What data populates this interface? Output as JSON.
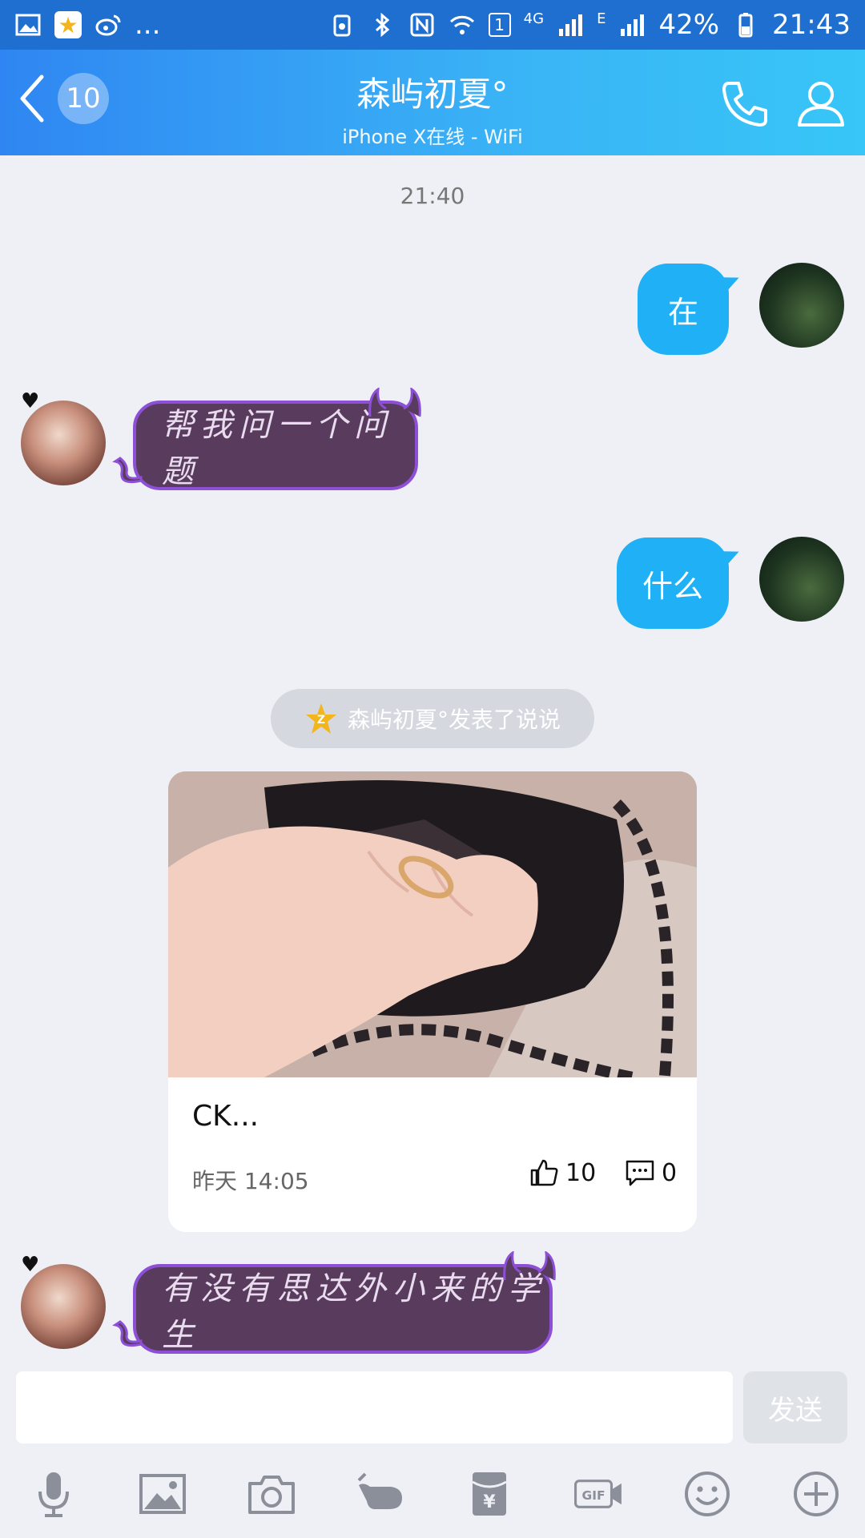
{
  "status_bar": {
    "left_overflow": "...",
    "network_4g": "4G",
    "network_e": "E",
    "sim_badge": "1",
    "battery": "42%",
    "time": "21:43"
  },
  "header": {
    "unread_count": "10",
    "title": "森屿初夏°",
    "subtitle": "iPhone X在线 - WiFi"
  },
  "chat": {
    "time_divider": "21:40",
    "messages": [
      {
        "side": "right",
        "text": "在"
      },
      {
        "side": "left",
        "text": "帮我问一个问题"
      },
      {
        "side": "right",
        "text": "什么"
      },
      {
        "side": "left",
        "text": "有没有思达外小来的学生"
      }
    ],
    "system_notice": "森屿初夏°发表了说说",
    "shared_post": {
      "title": "CK...",
      "date": "昨天 14:05",
      "likes": "10",
      "comments": "0"
    }
  },
  "composer": {
    "input_value": "",
    "send_label": "发送"
  },
  "toolbar_icons": [
    "microphone-icon",
    "image-icon",
    "camera-icon",
    "poke-hand-icon",
    "red-packet-icon",
    "gif-icon",
    "emoji-icon",
    "plus-icon"
  ],
  "colors": {
    "header_start": "#2f86f2",
    "header_end": "#37c6f7",
    "bubble_self": "#1fb0f5",
    "bubble_other": "#583b5d",
    "bubble_other_border": "#8c4fd6"
  }
}
